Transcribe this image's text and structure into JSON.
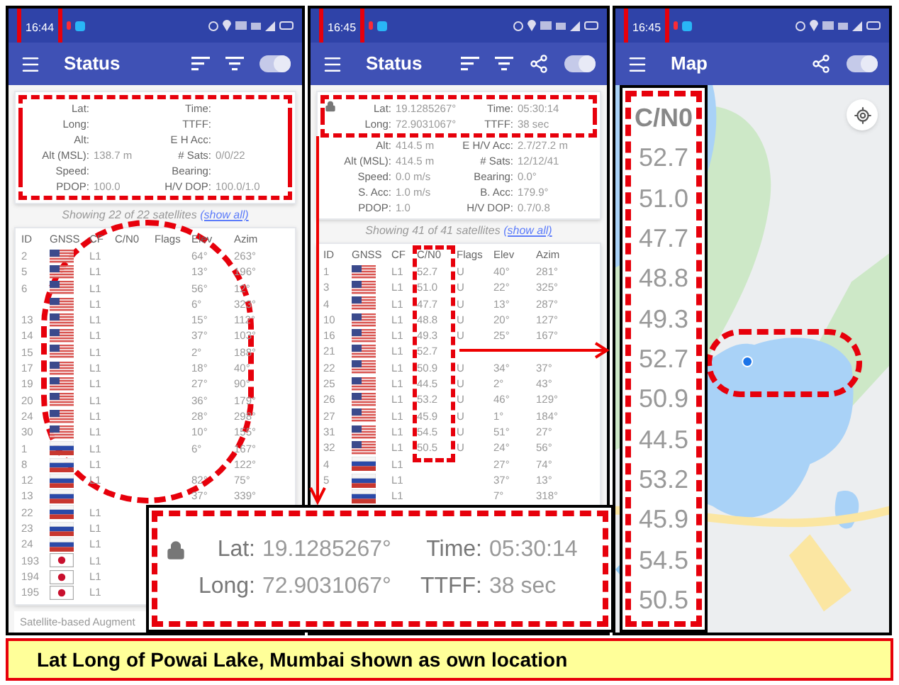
{
  "panels": [
    {
      "kind": "status",
      "status_time": "16:44",
      "time_highlighted": true,
      "title": "Status",
      "actions": [
        {
          "kind": "sort"
        },
        {
          "kind": "filter"
        },
        {
          "kind": "toggle"
        }
      ],
      "toggle_on": true,
      "info": {
        "locked": false,
        "rows": [
          {
            "highlighted": true,
            "cells": [
              {
                "label": "Lat:"
              },
              {
                "label": "Time:"
              }
            ]
          },
          {
            "highlighted": true,
            "cells": [
              {
                "label": "Long:"
              },
              {
                "label": "TTFF:"
              }
            ]
          },
          {
            "highlighted": true,
            "cells": [
              {
                "label": "Alt:"
              },
              {
                "label": "E H Acc:"
              }
            ]
          },
          {
            "highlighted": true,
            "cells": [
              {
                "label": "Alt (MSL):",
                "value": "138.7 m"
              },
              {
                "label": "# Sats:",
                "value": "0/0/22"
              }
            ]
          },
          {
            "highlighted": true,
            "cells": [
              {
                "label": "Speed:"
              },
              {
                "label": "Bearing:"
              }
            ]
          },
          {
            "highlighted": true,
            "cells": [
              {
                "label": "PDOP:",
                "value": "100.0"
              },
              {
                "label": "H/V DOP:",
                "value": "100.0/1.0"
              }
            ]
          }
        ]
      },
      "summary": "Showing 22 of 22 satellites",
      "summary_link": "(show all)",
      "circled": true,
      "table": {
        "columns": [
          {
            "label": "ID",
            "highlighted": false
          },
          {
            "label": "GNSS",
            "highlighted": false
          },
          {
            "label": "CF",
            "highlighted": false
          },
          {
            "label": "C/N0",
            "highlighted": false
          },
          {
            "label": "Flags",
            "highlighted": false
          },
          {
            "label": "Elev",
            "highlighted": false
          },
          {
            "label": "Azim",
            "highlighted": false
          }
        ],
        "rows": [
          {
            "id": "2",
            "kind": "us",
            "cf": "L1",
            "elev": "64°",
            "azim": "263°"
          },
          {
            "id": "5",
            "kind": "us",
            "cf": "L1",
            "elev": "13°",
            "azim": "196°"
          },
          {
            "id": "6",
            "kind": "us",
            "cf": "L1",
            "elev": "56°",
            "azim": "12°"
          },
          {
            "kind": "us",
            "cf": "L1",
            "elev": "6°",
            "azim": "323°"
          },
          {
            "id": "13",
            "kind": "us",
            "cf": "L1",
            "elev": "15°",
            "azim": "112°"
          },
          {
            "id": "14",
            "kind": "us",
            "cf": "L1",
            "elev": "37°",
            "azim": "103°"
          },
          {
            "id": "15",
            "kind": "us",
            "cf": "L1",
            "elev": "2°",
            "azim": "188°"
          },
          {
            "id": "17",
            "kind": "us",
            "cf": "L1",
            "elev": "18°",
            "azim": "40°"
          },
          {
            "id": "19",
            "kind": "us",
            "cf": "L1",
            "elev": "27°",
            "azim": "90°"
          },
          {
            "id": "20",
            "kind": "us",
            "cf": "L1",
            "elev": "36°",
            "azim": "179°"
          },
          {
            "id": "24",
            "kind": "us",
            "cf": "L1",
            "elev": "28°",
            "azim": "298°"
          },
          {
            "id": "30",
            "kind": "us",
            "cf": "L1",
            "elev": "10°",
            "azim": "155°"
          },
          {
            "id": "1",
            "kind": "ru",
            "cf": "L1",
            "elev": "6°",
            "azim": "167°"
          },
          {
            "id": "8",
            "kind": "ru",
            "cf": "L1",
            "azim": "122°"
          },
          {
            "id": "12",
            "kind": "ru",
            "cf": "L1",
            "elev": "82°",
            "azim": "75°"
          },
          {
            "id": "13",
            "kind": "ru",
            "elev": "37°",
            "azim": "339°"
          },
          {
            "id": "22",
            "kind": "ru",
            "cf": "L1"
          },
          {
            "id": "23",
            "kind": "ru",
            "cf": "L1"
          },
          {
            "id": "24",
            "kind": "ru",
            "cf": "L1"
          },
          {
            "id": "193",
            "kind": "jp",
            "cf": "L1"
          },
          {
            "id": "194",
            "kind": "jp",
            "cf": "L1"
          },
          {
            "id": "195",
            "kind": "jp",
            "cf": "L1"
          }
        ]
      },
      "footer": "Satellite-based Augment"
    },
    {
      "kind": "status",
      "status_time": "16:45",
      "time_highlighted": true,
      "title": "Status",
      "actions": [
        {
          "kind": "sort"
        },
        {
          "kind": "filter"
        },
        {
          "kind": "share"
        },
        {
          "kind": "toggle"
        }
      ],
      "toggle_on": true,
      "info": {
        "locked": true,
        "rows": [
          {
            "highlighted": true,
            "cells": [
              {
                "label": "Lat:",
                "value": "19.1285267°"
              },
              {
                "label": "Time:",
                "value": "05:30:14"
              }
            ]
          },
          {
            "highlighted": true,
            "cells": [
              {
                "label": "Long:",
                "value": "72.9031067°"
              },
              {
                "label": "TTFF:",
                "value": "38 sec"
              }
            ]
          },
          {
            "highlighted": false,
            "cells": [
              {
                "label": "Alt:",
                "value": "414.5 m"
              },
              {
                "label": "E H/V Acc:",
                "value": "2.7/27.2 m"
              }
            ]
          },
          {
            "highlighted": false,
            "cells": [
              {
                "label": "Alt (MSL):",
                "value": "414.5 m"
              },
              {
                "label": "# Sats:",
                "value": "12/12/41"
              }
            ]
          },
          {
            "highlighted": false,
            "cells": [
              {
                "label": "Speed:",
                "value": "0.0 m/s"
              },
              {
                "label": "Bearing:",
                "value": "0.0°"
              }
            ]
          },
          {
            "highlighted": false,
            "cells": [
              {
                "label": "S. Acc:",
                "value": "1.0 m/s"
              },
              {
                "label": "B. Acc:",
                "value": "179.9°"
              }
            ]
          },
          {
            "highlighted": false,
            "cells": [
              {
                "label": "PDOP:",
                "value": "1.0"
              },
              {
                "label": "H/V DOP:",
                "value": "0.7/0.8"
              }
            ]
          }
        ]
      },
      "summary": "Showing 41 of 41 satellites",
      "summary_link": "(show all)",
      "circled": false,
      "table": {
        "columns": [
          {
            "label": "ID",
            "highlighted": false
          },
          {
            "label": "GNSS",
            "highlighted": false
          },
          {
            "label": "CF",
            "highlighted": false
          },
          {
            "label": "C/N0",
            "highlighted": true
          },
          {
            "label": "Flags",
            "highlighted": false
          },
          {
            "label": "Elev",
            "highlighted": false
          },
          {
            "label": "Azim",
            "highlighted": false
          }
        ],
        "rows": [
          {
            "id": "1",
            "kind": "us",
            "cf": "L1",
            "cn0": "52.7",
            "flags": "U",
            "elev": "40°",
            "azim": "281°"
          },
          {
            "id": "3",
            "kind": "us",
            "cf": "L1",
            "cn0": "51.0",
            "flags": "U",
            "elev": "22°",
            "azim": "325°"
          },
          {
            "id": "4",
            "kind": "us",
            "cf": "L1",
            "cn0": "47.7",
            "flags": "U",
            "elev": "13°",
            "azim": "287°"
          },
          {
            "id": "10",
            "kind": "us",
            "cf": "L1",
            "cn0": "48.8",
            "flags": "U",
            "elev": "20°",
            "azim": "127°"
          },
          {
            "id": "16",
            "kind": "us",
            "cf": "L1",
            "cn0": "49.3",
            "flags": "U",
            "elev": "25°",
            "azim": "167°"
          },
          {
            "id": "21",
            "kind": "us",
            "cf": "L1",
            "cn0": "52.7"
          },
          {
            "id": "22",
            "kind": "us",
            "cf": "L1",
            "cn0": "50.9",
            "flags": "U",
            "elev": "34°",
            "azim": "37°"
          },
          {
            "id": "25",
            "kind": "us",
            "cf": "L1",
            "cn0": "44.5",
            "flags": "U",
            "elev": "2°",
            "azim": "43°"
          },
          {
            "id": "26",
            "kind": "us",
            "cf": "L1",
            "cn0": "53.2",
            "flags": "U",
            "elev": "46°",
            "azim": "129°"
          },
          {
            "id": "27",
            "kind": "us",
            "cf": "L1",
            "cn0": "45.9",
            "flags": "U",
            "elev": "1°",
            "azim": "184°"
          },
          {
            "id": "31",
            "kind": "us",
            "cf": "L1",
            "cn0": "54.5",
            "flags": "U",
            "elev": "51°",
            "azim": "27°"
          },
          {
            "id": "32",
            "kind": "us",
            "cf": "L1",
            "cn0": "50.5",
            "flags": "U",
            "elev": "24°",
            "azim": "56°"
          },
          {
            "id": "4",
            "kind": "ru",
            "cf": "L1",
            "elev": "27°",
            "azim": "74°"
          },
          {
            "id": "5",
            "kind": "ru",
            "cf": "L1",
            "elev": "37°",
            "azim": "13°"
          },
          {
            "kind": "ru",
            "cf": "L1",
            "elev": "7°",
            "azim": "318°"
          }
        ]
      }
    },
    {
      "kind": "map",
      "status_time": "16:45",
      "time_highlighted": true,
      "title": "Map",
      "actions": [
        {
          "kind": "share"
        },
        {
          "kind": "toggle"
        }
      ],
      "toggle_on": true
    }
  ],
  "zoom_inset": {
    "locked": true,
    "rows": [
      [
        {
          "label": "Lat:",
          "value": "19.1285267°"
        },
        {
          "label": "Time:",
          "value": "05:30:14"
        }
      ],
      [
        {
          "label": "Long:",
          "value": "72.9031067°"
        },
        {
          "label": "TTFF:",
          "value": "38 sec"
        }
      ]
    ]
  },
  "cn0_zoom": {
    "header": "C/N0",
    "values": [
      "52.7",
      "51.0",
      "47.7",
      "48.8",
      "49.3",
      "52.7",
      "50.9",
      "44.5",
      "53.2",
      "45.9",
      "54.5",
      "50.5"
    ]
  },
  "caption": "Lat Long of Powai Lake, Mumbai shown as own location"
}
